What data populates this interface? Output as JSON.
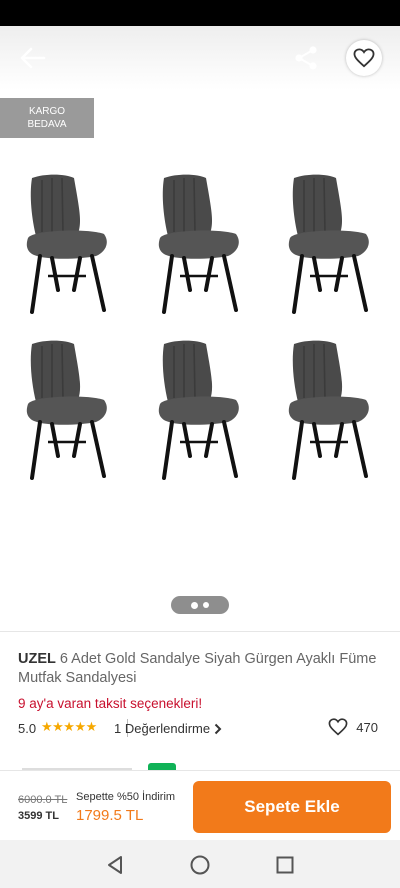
{
  "header": {
    "back_icon": "arrow-left-icon",
    "share_icon": "share-icon",
    "favorite_icon": "heart-outline-icon"
  },
  "gallery": {
    "badge": "KARGO\nBEDAVA",
    "page_count": 2,
    "active_page": 1,
    "chair_color": "#4a4a4a",
    "leg_color": "#111111"
  },
  "product": {
    "brand": "UZEL",
    "name": "6 Adet Gold Sandalye Siyah Gürgen Ayaklı Füme Mutfak Sandalyesi",
    "installment_text": "9 ay'a varan taksit seçenekleri!",
    "rating": "5.0",
    "stars": "★★★★★",
    "reviews_label": "1 Değerlendirme",
    "favorites_count": "470"
  },
  "bottom_bar": {
    "old_price": "6000.0 TL",
    "current_price": "3599 TL",
    "basket_label": "Sepette %50 İndirim",
    "basket_price": "1799.5 TL",
    "add_button": "Sepete Ekle"
  },
  "colors": {
    "accent": "#f27a1a",
    "installment": "#c8102e",
    "stars": "#f6a800"
  },
  "system_nav": {
    "back_icon": "triangle-back-icon",
    "home_icon": "circle-home-icon",
    "recents_icon": "square-recents-icon"
  }
}
